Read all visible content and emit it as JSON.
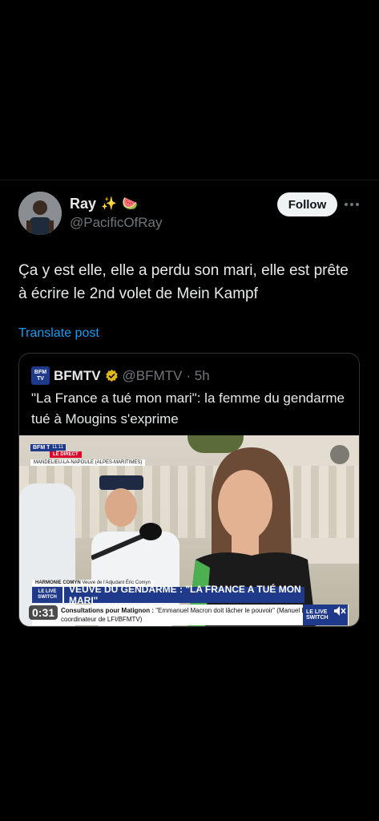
{
  "post": {
    "author_name": "Ray",
    "author_emoji_1": "✨",
    "author_emoji_2": "🍉",
    "handle": "@PacificOfRay",
    "follow_label": "Follow",
    "text": "Ça y est elle, elle a perdu son mari, elle est prête à écrire le 2nd volet de Mein Kampf",
    "translate_label": "Translate post"
  },
  "quote": {
    "logo_text": "BFM TV",
    "name": "BFMTV",
    "handle": "@BFMTV",
    "time": "· 5h",
    "text": "\"La France a tué mon mari\": la femme du gendarme tué à Mougins s'exprime",
    "video": {
      "channel_badge": "BFM TV",
      "time_badge": "11:11",
      "direct_badge": "LE DIRECT",
      "location": "MANDELIEU-LA-NAPOULE (ALPES-MARITIMES)",
      "speaker_name": "HARMONIE COMYN",
      "speaker_role": "Veuve de l'Adjudant Éric Comyn",
      "live_switch": "LE LIVE SWITCH",
      "headline": "VEUVE DU GENDARME : \"LA FRANCE A TUÉ MON MARI\"",
      "ticker_bold": "Consultations pour Matignon :",
      "ticker_text": "\"Emmanuel Macron doit lâcher le pouvoir\" (Manuel Bompard, coordinateur de LFI/BFMTV)",
      "ticker_end": "LE LIVE SWITCH",
      "duration": "0:31"
    }
  },
  "colors": {
    "background": "#000000",
    "link": "#1d9bf0",
    "muted": "#71767b",
    "verified": "#e2b719",
    "bfm_blue": "#1f3a8a"
  }
}
